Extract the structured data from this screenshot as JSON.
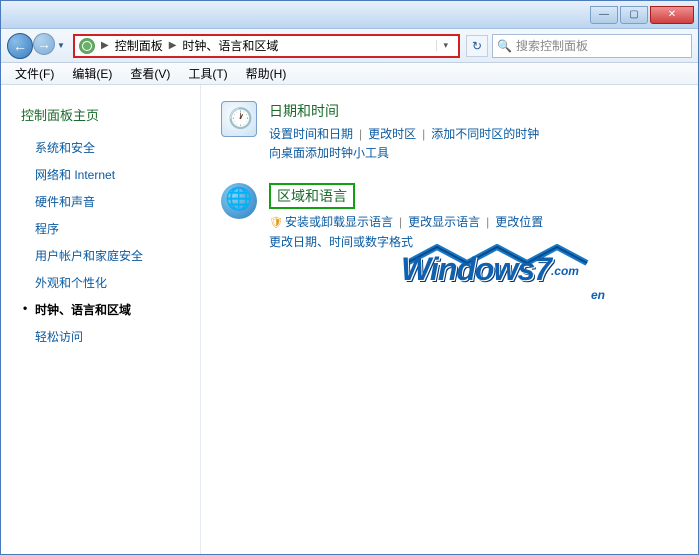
{
  "titlebar": {},
  "nav": {
    "breadcrumb_root": "控制面板",
    "breadcrumb_current": "时钟、语言和区域",
    "search_placeholder": "搜索控制面板"
  },
  "menu": {
    "file": "文件(F)",
    "edit": "编辑(E)",
    "view": "查看(V)",
    "tools": "工具(T)",
    "help": "帮助(H)"
  },
  "sidebar": {
    "title": "控制面板主页",
    "items": [
      "系统和安全",
      "网络和 Internet",
      "硬件和声音",
      "程序",
      "用户帐户和家庭安全",
      "外观和个性化",
      "时钟、语言和区域",
      "轻松访问"
    ],
    "active_index": 6
  },
  "content": {
    "datetime": {
      "title": "日期和时间",
      "link1": "设置时间和日期",
      "link2": "更改时区",
      "link3": "添加不同时区的时钟",
      "link4": "向桌面添加时钟小工具"
    },
    "region": {
      "title": "区域和语言",
      "link1": "安装或卸载显示语言",
      "link2": "更改显示语言",
      "link3": "更改位置",
      "link4": "更改日期、时间或数字格式"
    }
  },
  "watermark": {
    "text_main": "Windows7",
    "text_suffix_top": ".com",
    "text_suffix_bottom": "en"
  }
}
